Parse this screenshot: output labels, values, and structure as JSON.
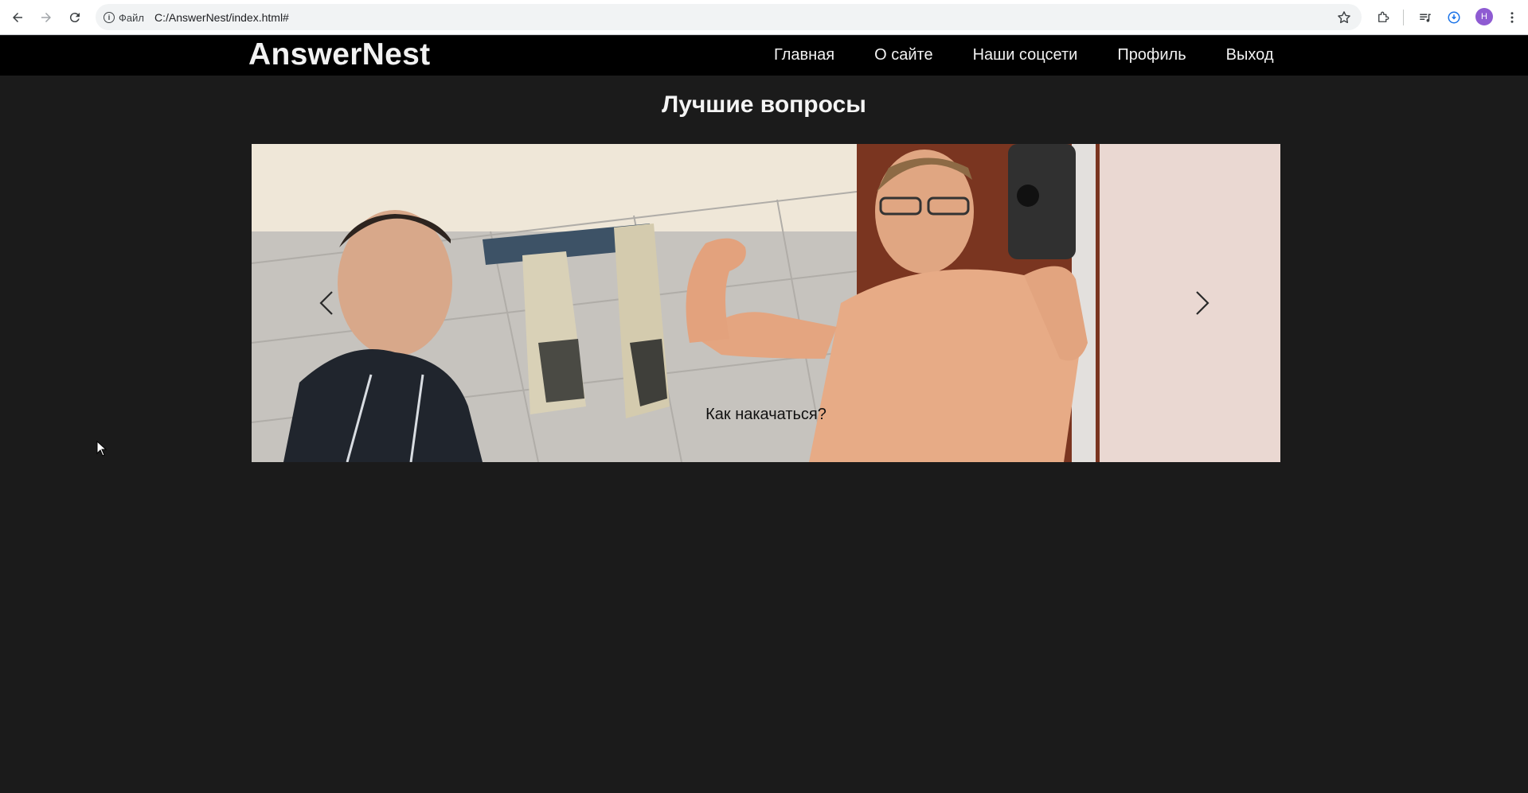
{
  "browser": {
    "site_info_label": "Файл",
    "url": "C:/AnswerNest/index.html#",
    "profile_initial": "H"
  },
  "site": {
    "logo": "AnswerNest",
    "nav": [
      {
        "label": "Главная"
      },
      {
        "label": "О сайте"
      },
      {
        "label": "Наши соцсети"
      },
      {
        "label": "Профиль"
      },
      {
        "label": "Выход"
      }
    ]
  },
  "main": {
    "title": "Лучшие вопросы",
    "carousel": {
      "active_caption": "Как накачаться?"
    }
  },
  "colors": {
    "page_background": "#1b1b1b",
    "header_background": "#000000",
    "text": "#f2f2f2"
  }
}
